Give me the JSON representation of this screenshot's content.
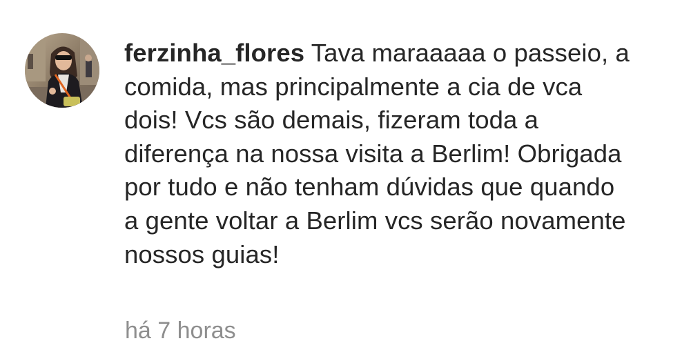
{
  "comment": {
    "username": "ferzinha_flores",
    "text": "Tava maraaaaa o passeio, a comida, mas principalmente a cia de vca dois! Vcs são demais, fizeram toda a diferença na nossa visita a Berlim! Obrigada por tudo e não tenham dúvidas que quando a gente voltar a Berlim vcs serão novamente nossos guias!",
    "timestamp": "há 7 horas",
    "avatar_icon": "user-avatar-photo"
  },
  "colors": {
    "text": "#262626",
    "muted": "#8e8e8e",
    "background": "#ffffff"
  }
}
